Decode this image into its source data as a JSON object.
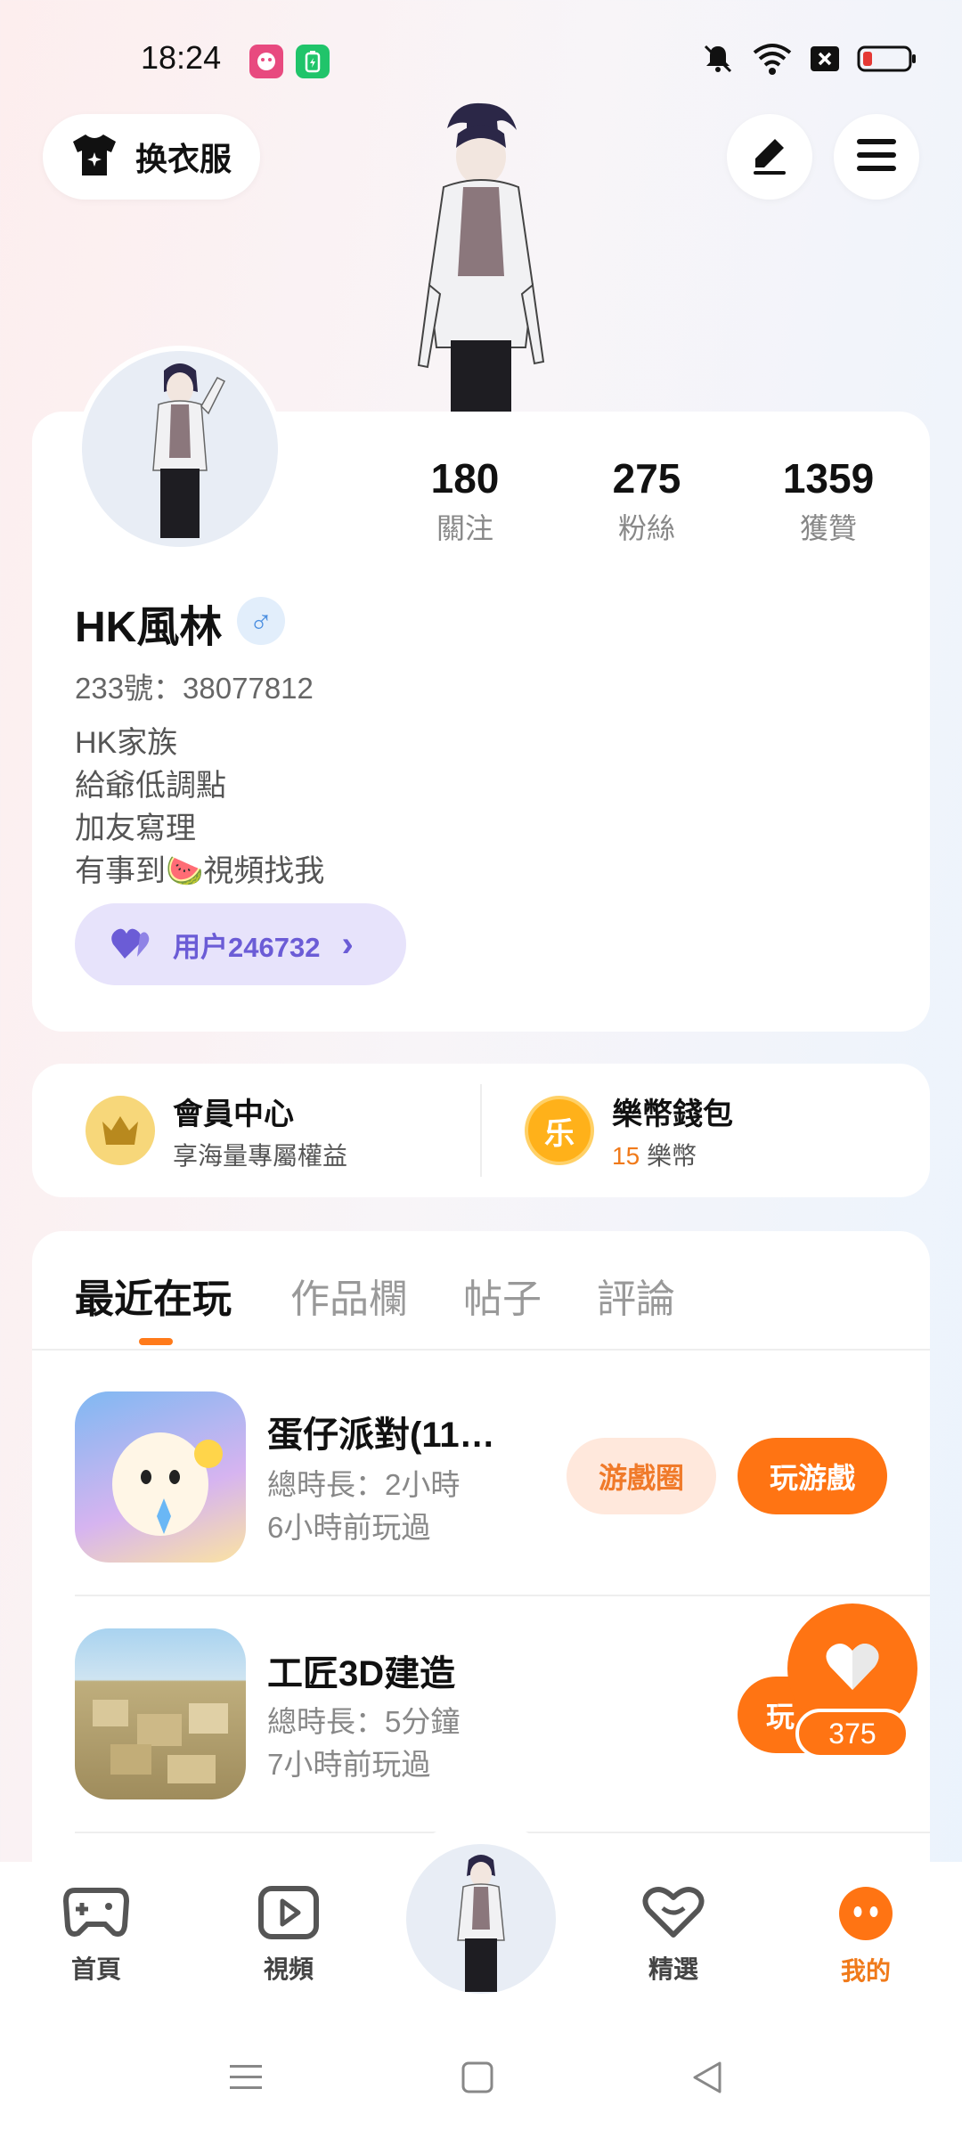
{
  "status_bar": {
    "time": "18:24"
  },
  "header": {
    "outfit_label": "换衣服"
  },
  "profile": {
    "stats": [
      {
        "value": "180",
        "label": "關注"
      },
      {
        "value": "275",
        "label": "粉絲"
      },
      {
        "value": "1359",
        "label": "獲贊"
      }
    ],
    "username": "HK風林",
    "gender_symbol": "♂",
    "uid": "233號：38077812",
    "bio": [
      "HK家族",
      "給爺低調點",
      "加友寫理",
      "有事到🍉視頻找我"
    ],
    "family_label": "用户246732",
    "family_chevron": "›"
  },
  "member": {
    "vip_title": "會員中心",
    "vip_sub": "享海量專屬權益",
    "wallet_title": "樂幣錢包",
    "wallet_amount": "15",
    "wallet_unit": "樂幣",
    "wallet_icon_char": "乐"
  },
  "tabs": [
    "最近在玩",
    "作品欄",
    "帖子",
    "評論"
  ],
  "games": [
    {
      "title": "蛋仔派對(11…",
      "duration": "總時長：2小時",
      "last_played": "6小時前玩過",
      "circle_label": "游戲圈",
      "play_label": "玩游戲"
    },
    {
      "title": "工匠3D建造",
      "duration": "總時長：5分鐘",
      "last_played": "7小時前玩過",
      "play_label": "玩"
    }
  ],
  "like_count": "375",
  "bottom_nav": [
    {
      "label": "首頁"
    },
    {
      "label": "視頻"
    },
    {
      "label": "精選"
    },
    {
      "label": "我的"
    }
  ],
  "colors": {
    "accent": "#ff7413",
    "purple": "#6b5cd6"
  }
}
